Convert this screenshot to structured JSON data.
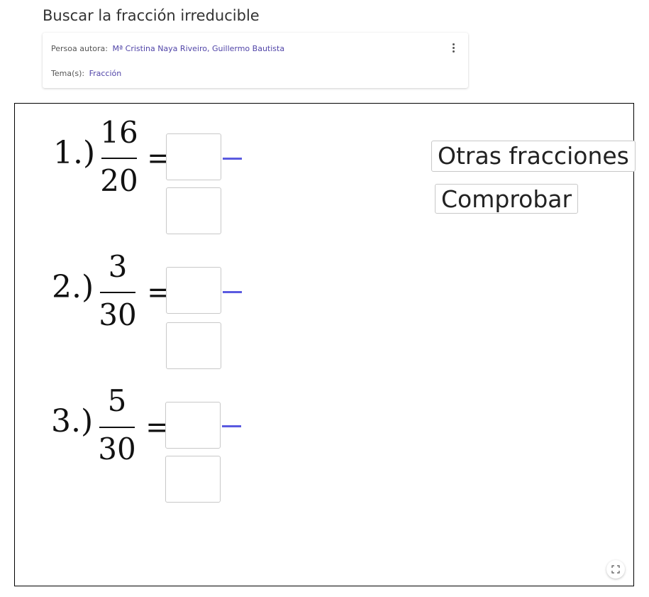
{
  "page": {
    "title": "Buscar la fracción irreducible"
  },
  "info_card": {
    "author_label": "Persoa autora:",
    "author_value": "Mª Cristina Naya Riveiro, Guillermo Bautista",
    "topic_label": "Tema(s):",
    "topic_value": "Fracción",
    "menu_icon": "more-vert-icon"
  },
  "applet": {
    "exercises": [
      {
        "label": "1.)",
        "numerator": "16",
        "denominator": "20",
        "equals": "="
      },
      {
        "label": "2.)",
        "numerator": "3",
        "denominator": "30",
        "equals": "="
      },
      {
        "label": "3.)",
        "numerator": "5",
        "denominator": "30",
        "equals": "="
      }
    ],
    "buttons": {
      "other_fractions": "Otras fracciones",
      "check": "Comprobar"
    },
    "fullscreen_icon": "fullscreen-icon",
    "colors": {
      "answer_bar": "#5a5ae0",
      "link": "#5145a8"
    }
  }
}
